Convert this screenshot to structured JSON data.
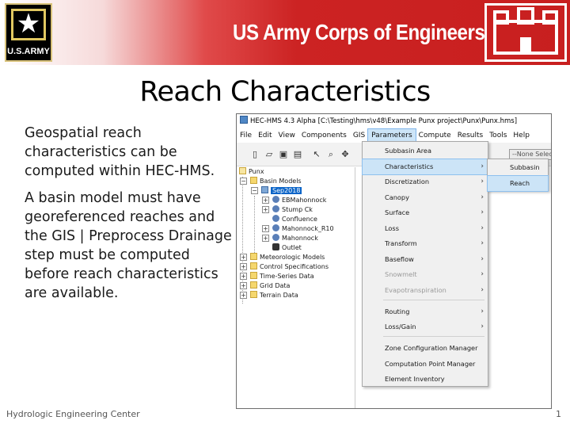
{
  "banner": {
    "army_logo_text": "U.S.ARMY",
    "title": "US Army Corps of Engineers",
    "colors": {
      "banner_red": "#c81f1f",
      "logo_gold": "#e1c861"
    }
  },
  "slide": {
    "title": "Reach Characteristics",
    "paragraph1": "Geospatial reach characteristics can be computed within HEC-HMS.",
    "paragraph2": "A basin model must have georeferenced reaches and the GIS | Preprocess Drainage step must be computed before reach characteristics are available.",
    "footer_left": "Hydrologic Engineering Center",
    "page_number": "1"
  },
  "window": {
    "title": "HEC-HMS 4.3 Alpha [C:\\Testing\\hms\\v48\\Example Punx project\\Punx\\Punx.hms]",
    "menu": [
      "File",
      "Edit",
      "View",
      "Components",
      "GIS",
      "Parameters",
      "Compute",
      "Results",
      "Tools",
      "Help"
    ],
    "active_menu": "Parameters",
    "toolbar_combo": "--None Selected--",
    "tree": {
      "project": "Punx",
      "basin_models": "Basin Models",
      "selected_basin": "Sep2018",
      "elements": [
        "EBMahonnock",
        "Stump Ck",
        "Confluence",
        "Mahonnock_R10",
        "Mahonnock",
        "Outlet"
      ],
      "folders": [
        "Meteorologic Models",
        "Control Specifications",
        "Time-Series Data",
        "Grid Data",
        "Terrain Data"
      ]
    },
    "parameters_menu": {
      "items": [
        {
          "label": "Subbasin Area",
          "submenu": false,
          "disabled": false
        },
        {
          "label": "Characteristics",
          "submenu": true,
          "disabled": false,
          "highlighted": true
        },
        {
          "label": "Discretization",
          "submenu": true,
          "disabled": false
        },
        {
          "label": "Canopy",
          "submenu": true,
          "disabled": false
        },
        {
          "label": "Surface",
          "submenu": true,
          "disabled": false
        },
        {
          "label": "Loss",
          "submenu": true,
          "disabled": false
        },
        {
          "label": "Transform",
          "submenu": true,
          "disabled": false
        },
        {
          "label": "Baseflow",
          "submenu": true,
          "disabled": false
        },
        {
          "label": "Snowmelt",
          "submenu": true,
          "disabled": true
        },
        {
          "label": "Evapotranspiration",
          "submenu": true,
          "disabled": true
        },
        {
          "label": "Routing",
          "submenu": true,
          "disabled": false
        },
        {
          "label": "Loss/Gain",
          "submenu": true,
          "disabled": false
        },
        {
          "label": "Zone Configuration Manager",
          "submenu": false,
          "disabled": false
        },
        {
          "label": "Computation Point Manager",
          "submenu": false,
          "disabled": false
        },
        {
          "label": "Element Inventory",
          "submenu": false,
          "disabled": false
        }
      ],
      "submenu": [
        "Subbasin",
        "Reach"
      ],
      "submenu_highlighted": "Reach"
    }
  }
}
